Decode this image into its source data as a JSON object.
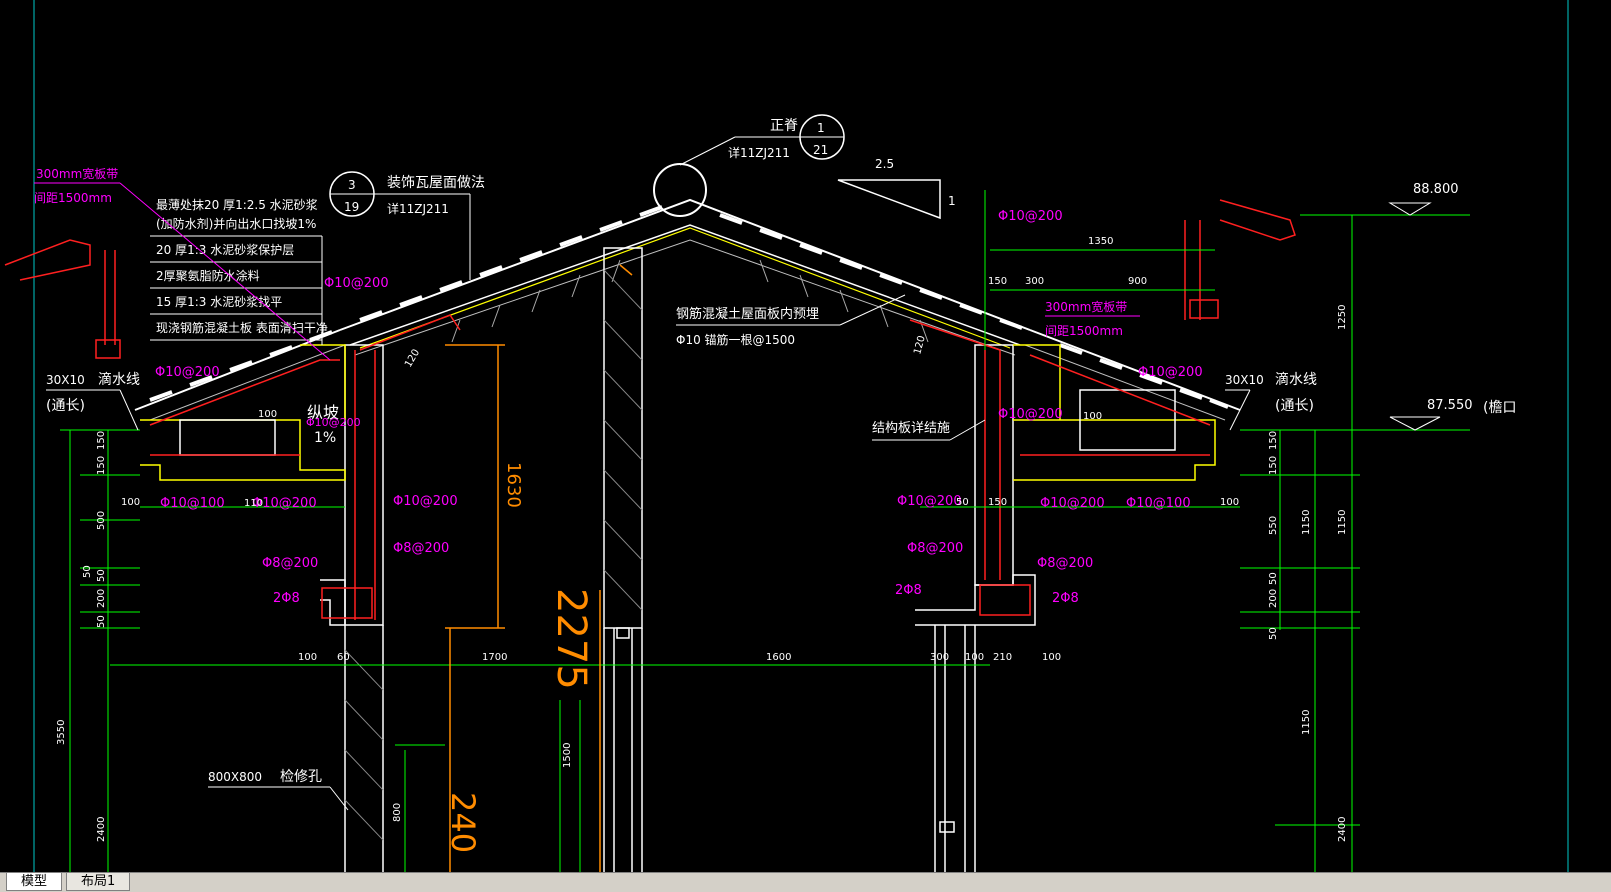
{
  "tabs": [
    {
      "label": "模型",
      "active": true
    },
    {
      "label": "布局1",
      "active": false
    }
  ],
  "drawing": {
    "ridge": {
      "label": "正脊",
      "ref": "详11ZJ211",
      "circle_top": "1",
      "circle_bottom": "21"
    },
    "roof": {
      "label": "装饰瓦屋面做法",
      "ref": "详11ZJ211",
      "circle_top": "3",
      "circle_bottom": "19"
    },
    "slope": {
      "run": "2.5",
      "rise": "1"
    },
    "gutter_left": {
      "line1": "300mm宽板带",
      "line2": "间距1500mm"
    },
    "gutter_right": {
      "line1": "300mm宽板带",
      "line2": "间距1500mm"
    },
    "layers": [
      "最薄处抹20 厚1:2.5  水泥砂浆",
      "(加防水剂)并向出水口找坡1%",
      "20 厚1:3  水泥砂浆保护层",
      "2厚聚氨脂防水涂料",
      "15 厚1:3  水泥砂浆找平",
      "现浇钢筋混凝土板 表面清扫干净"
    ],
    "drip_left": {
      "size": "30X10",
      "name": "滴水线",
      "note": "(通长)"
    },
    "drip_right": {
      "size": "30X10",
      "name": "滴水线",
      "note": "(通长)"
    },
    "slope_note": {
      "a": "纵坡",
      "b": "1%"
    },
    "anchor_note": {
      "line1": "钢筋混凝土屋面板内预埋",
      "line2": "Φ10  锚筋一根@1500"
    },
    "struct_note": "结构板详结施",
    "access": {
      "size": "800X800",
      "name": "检修孔"
    },
    "elev": {
      "top": "88.800",
      "eave": "87.550",
      "eave_note": "(檐口"
    },
    "rebar": {
      "a": "Φ10@200",
      "b": "Φ10@200",
      "c": "Φ10@200",
      "d": "Φ10@200",
      "e": "Φ10@100",
      "f": "Φ10@200",
      "g": "Φ10@200",
      "h": "Φ8@200",
      "i": "Φ8@200",
      "j": "2Φ8",
      "k": "Φ10@200",
      "l": "Φ10@200",
      "m": "Φ10@200",
      "n": "Φ10@200",
      "o": "Φ10@100",
      "p": "Φ8@200",
      "q": "Φ8@200",
      "r": "2Φ8",
      "s": "2Φ8"
    },
    "dims": {
      "d1630": "1630",
      "d1700": "1700",
      "d1600": "1600",
      "d1350": "1350",
      "d150": "150",
      "d300": "300",
      "d900": "900",
      "d100": "100",
      "d60": "60",
      "d50": "50",
      "d200": "200",
      "d500": "500",
      "d550": "550",
      "d3550": "3550",
      "d2400": "2400",
      "d1250": "1250",
      "d1150": "1150",
      "d120": "120",
      "d1500": "1500",
      "d800": "800",
      "d210": "210",
      "d110": "110",
      "big1": "2275",
      "big2": "240"
    }
  }
}
